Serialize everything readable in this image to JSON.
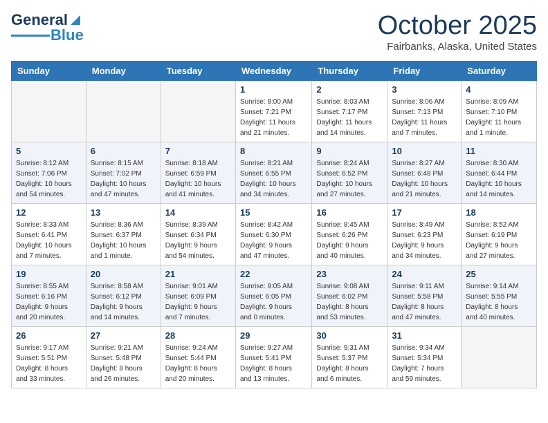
{
  "header": {
    "logo_general": "General",
    "logo_blue": "Blue",
    "month": "October 2025",
    "location": "Fairbanks, Alaska, United States"
  },
  "days_of_week": [
    "Sunday",
    "Monday",
    "Tuesday",
    "Wednesday",
    "Thursday",
    "Friday",
    "Saturday"
  ],
  "weeks": [
    {
      "shaded": false,
      "days": [
        {
          "num": "",
          "info": ""
        },
        {
          "num": "",
          "info": ""
        },
        {
          "num": "",
          "info": ""
        },
        {
          "num": "1",
          "info": "Sunrise: 8:00 AM\nSunset: 7:21 PM\nDaylight: 11 hours\nand 21 minutes."
        },
        {
          "num": "2",
          "info": "Sunrise: 8:03 AM\nSunset: 7:17 PM\nDaylight: 11 hours\nand 14 minutes."
        },
        {
          "num": "3",
          "info": "Sunrise: 8:06 AM\nSunset: 7:13 PM\nDaylight: 11 hours\nand 7 minutes."
        },
        {
          "num": "4",
          "info": "Sunrise: 8:09 AM\nSunset: 7:10 PM\nDaylight: 11 hours\nand 1 minute."
        }
      ]
    },
    {
      "shaded": true,
      "days": [
        {
          "num": "5",
          "info": "Sunrise: 8:12 AM\nSunset: 7:06 PM\nDaylight: 10 hours\nand 54 minutes."
        },
        {
          "num": "6",
          "info": "Sunrise: 8:15 AM\nSunset: 7:02 PM\nDaylight: 10 hours\nand 47 minutes."
        },
        {
          "num": "7",
          "info": "Sunrise: 8:18 AM\nSunset: 6:59 PM\nDaylight: 10 hours\nand 41 minutes."
        },
        {
          "num": "8",
          "info": "Sunrise: 8:21 AM\nSunset: 6:55 PM\nDaylight: 10 hours\nand 34 minutes."
        },
        {
          "num": "9",
          "info": "Sunrise: 8:24 AM\nSunset: 6:52 PM\nDaylight: 10 hours\nand 27 minutes."
        },
        {
          "num": "10",
          "info": "Sunrise: 8:27 AM\nSunset: 6:48 PM\nDaylight: 10 hours\nand 21 minutes."
        },
        {
          "num": "11",
          "info": "Sunrise: 8:30 AM\nSunset: 6:44 PM\nDaylight: 10 hours\nand 14 minutes."
        }
      ]
    },
    {
      "shaded": false,
      "days": [
        {
          "num": "12",
          "info": "Sunrise: 8:33 AM\nSunset: 6:41 PM\nDaylight: 10 hours\nand 7 minutes."
        },
        {
          "num": "13",
          "info": "Sunrise: 8:36 AM\nSunset: 6:37 PM\nDaylight: 10 hours\nand 1 minute."
        },
        {
          "num": "14",
          "info": "Sunrise: 8:39 AM\nSunset: 6:34 PM\nDaylight: 9 hours\nand 54 minutes."
        },
        {
          "num": "15",
          "info": "Sunrise: 8:42 AM\nSunset: 6:30 PM\nDaylight: 9 hours\nand 47 minutes."
        },
        {
          "num": "16",
          "info": "Sunrise: 8:45 AM\nSunset: 6:26 PM\nDaylight: 9 hours\nand 40 minutes."
        },
        {
          "num": "17",
          "info": "Sunrise: 8:49 AM\nSunset: 6:23 PM\nDaylight: 9 hours\nand 34 minutes."
        },
        {
          "num": "18",
          "info": "Sunrise: 8:52 AM\nSunset: 6:19 PM\nDaylight: 9 hours\nand 27 minutes."
        }
      ]
    },
    {
      "shaded": true,
      "days": [
        {
          "num": "19",
          "info": "Sunrise: 8:55 AM\nSunset: 6:16 PM\nDaylight: 9 hours\nand 20 minutes."
        },
        {
          "num": "20",
          "info": "Sunrise: 8:58 AM\nSunset: 6:12 PM\nDaylight: 9 hours\nand 14 minutes."
        },
        {
          "num": "21",
          "info": "Sunrise: 9:01 AM\nSunset: 6:09 PM\nDaylight: 9 hours\nand 7 minutes."
        },
        {
          "num": "22",
          "info": "Sunrise: 9:05 AM\nSunset: 6:05 PM\nDaylight: 9 hours\nand 0 minutes."
        },
        {
          "num": "23",
          "info": "Sunrise: 9:08 AM\nSunset: 6:02 PM\nDaylight: 8 hours\nand 53 minutes."
        },
        {
          "num": "24",
          "info": "Sunrise: 9:11 AM\nSunset: 5:58 PM\nDaylight: 8 hours\nand 47 minutes."
        },
        {
          "num": "25",
          "info": "Sunrise: 9:14 AM\nSunset: 5:55 PM\nDaylight: 8 hours\nand 40 minutes."
        }
      ]
    },
    {
      "shaded": false,
      "days": [
        {
          "num": "26",
          "info": "Sunrise: 9:17 AM\nSunset: 5:51 PM\nDaylight: 8 hours\nand 33 minutes."
        },
        {
          "num": "27",
          "info": "Sunrise: 9:21 AM\nSunset: 5:48 PM\nDaylight: 8 hours\nand 26 minutes."
        },
        {
          "num": "28",
          "info": "Sunrise: 9:24 AM\nSunset: 5:44 PM\nDaylight: 8 hours\nand 20 minutes."
        },
        {
          "num": "29",
          "info": "Sunrise: 9:27 AM\nSunset: 5:41 PM\nDaylight: 8 hours\nand 13 minutes."
        },
        {
          "num": "30",
          "info": "Sunrise: 9:31 AM\nSunset: 5:37 PM\nDaylight: 8 hours\nand 6 minutes."
        },
        {
          "num": "31",
          "info": "Sunrise: 9:34 AM\nSunset: 5:34 PM\nDaylight: 7 hours\nand 59 minutes."
        },
        {
          "num": "",
          "info": ""
        }
      ]
    }
  ]
}
